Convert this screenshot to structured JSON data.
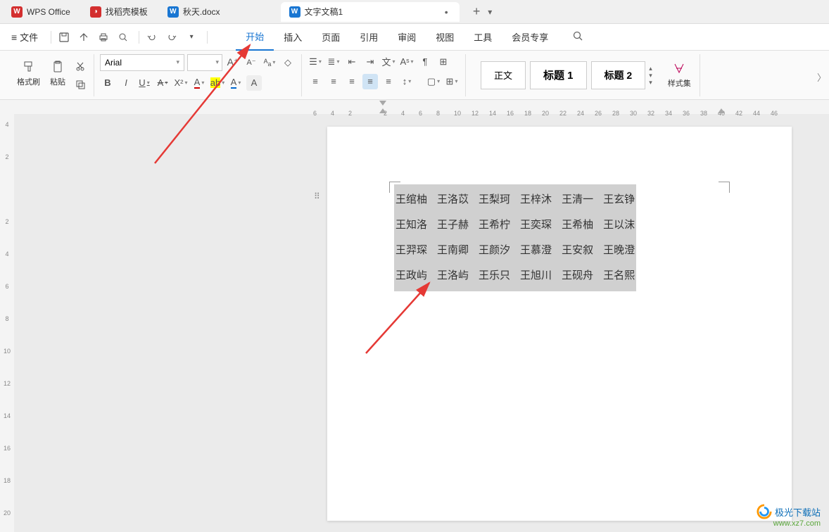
{
  "tabs": {
    "items": [
      {
        "label": "WPS Office",
        "icon": "wps"
      },
      {
        "label": "找稻壳模板",
        "icon": "dao"
      },
      {
        "label": "秋天.docx",
        "icon": "doc"
      },
      {
        "label": "文字文稿1",
        "icon": "doc",
        "active": true
      }
    ],
    "add": "+"
  },
  "menu": {
    "file": "文件",
    "tabs": [
      "开始",
      "插入",
      "页面",
      "引用",
      "审阅",
      "视图",
      "工具",
      "会员专享"
    ],
    "active": "开始"
  },
  "ribbon": {
    "format_painter": "格式刷",
    "paste": "粘贴",
    "font_name": "Arial",
    "font_size": "",
    "bold": "B",
    "italic": "I",
    "underline": "U",
    "strike": "S",
    "styles": {
      "normal": "正文",
      "h1": "标题 1",
      "h2": "标题 2",
      "gallery_label": "样式集"
    }
  },
  "ruler": {
    "h_ticks": [
      6,
      4,
      2,
      "",
      2,
      4,
      6,
      8,
      10,
      12,
      14,
      16,
      18,
      20,
      22,
      24,
      26,
      28,
      30,
      32,
      34,
      36,
      38,
      40,
      42,
      44,
      46
    ],
    "v_ticks": [
      4,
      2,
      "",
      2,
      4,
      6,
      8,
      10,
      12,
      14,
      16,
      18,
      20
    ]
  },
  "document": {
    "rows": [
      [
        "王绾柚",
        "王洛苡",
        "王梨珂",
        "王梓沐",
        "王清一",
        "王玄铮"
      ],
      [
        "王知洛",
        "王子赫",
        "王希柠",
        "王奕琛",
        "王希柚",
        "王以沫"
      ],
      [
        "王羿琛",
        "王南卿",
        "王颜汐",
        "王慕澄",
        "王安叙",
        "王晚澄"
      ],
      [
        "王政屿",
        "王洛屿",
        "王乐只",
        "王旭川",
        "王砚舟",
        "王名熙"
      ]
    ]
  },
  "watermark": {
    "line1": "极光下载站",
    "line2": "www.xz7.com"
  }
}
